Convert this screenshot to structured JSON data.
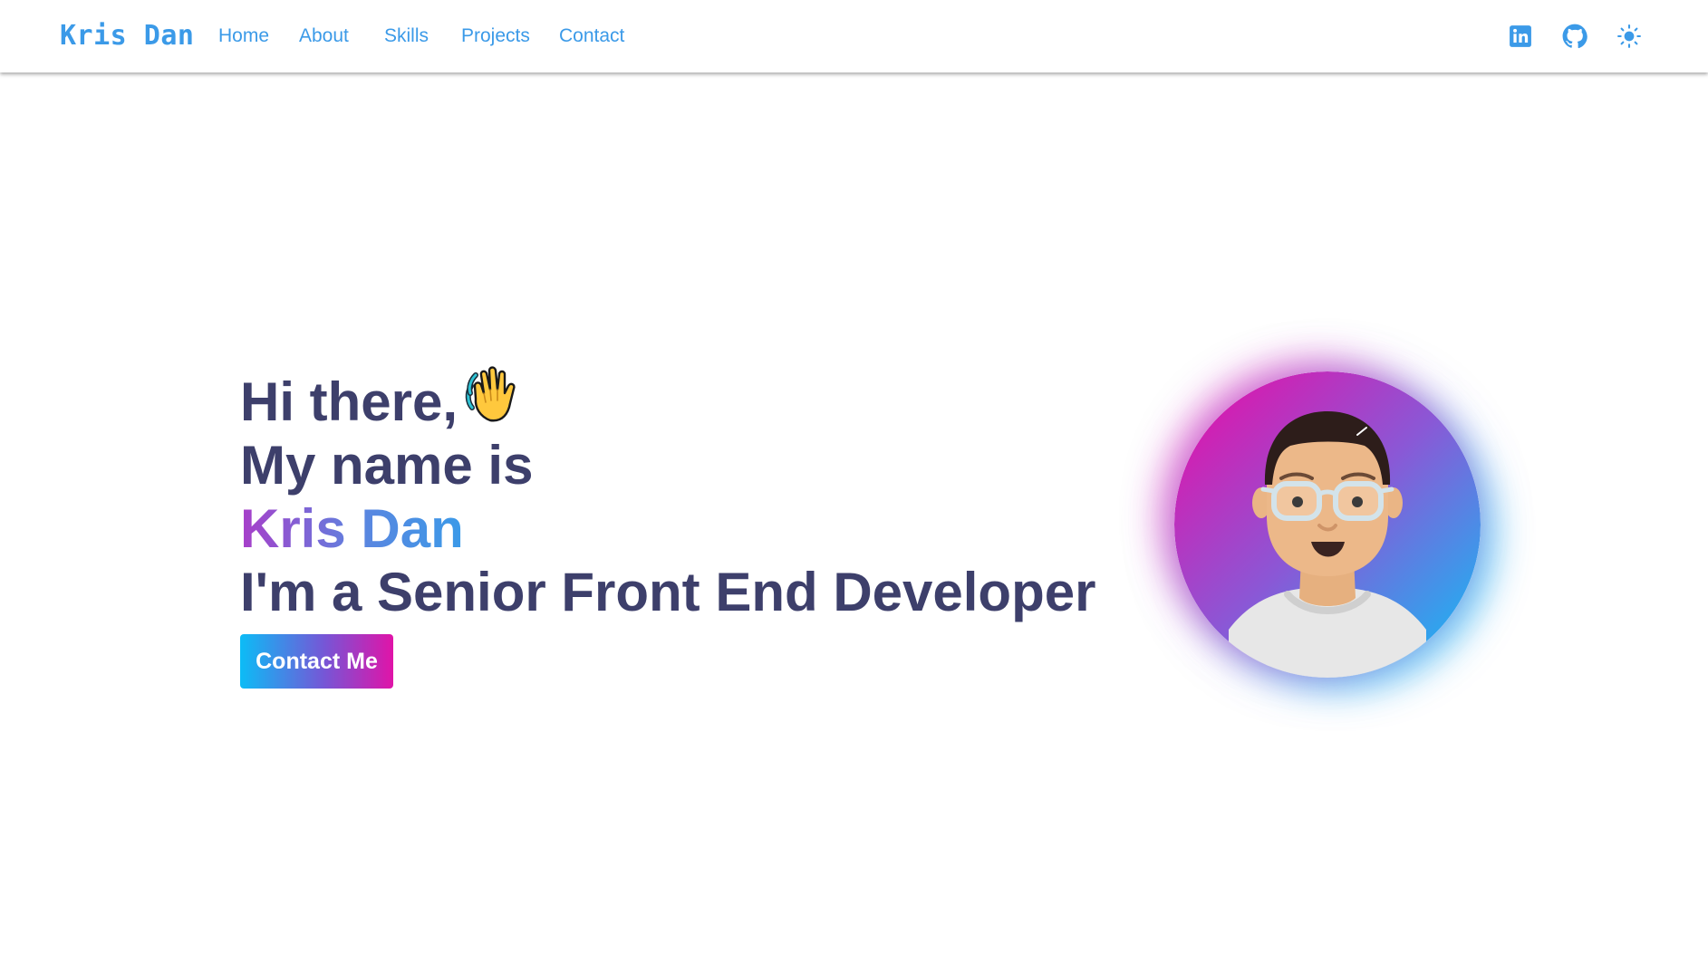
{
  "nav": {
    "brand": "Kris Dan",
    "links": [
      "Home",
      "About",
      "Skills",
      "Projects",
      "Contact"
    ],
    "icons": [
      "linkedin-icon",
      "github-icon",
      "sun-icon"
    ]
  },
  "hero": {
    "line1": "Hi there,",
    "wave_emoji": "waving-hand-icon",
    "line2": "My name is",
    "name": "Kris Dan",
    "line4": "I'm a Senior Front End Developer",
    "cta_label": "Contact Me"
  },
  "colors": {
    "accent": "#3b9ae8",
    "heading": "#3d3f6b",
    "gradient_pink": "#e014a8",
    "gradient_cyan": "#0cbcf6",
    "gradient_purple": "#7656d6"
  }
}
